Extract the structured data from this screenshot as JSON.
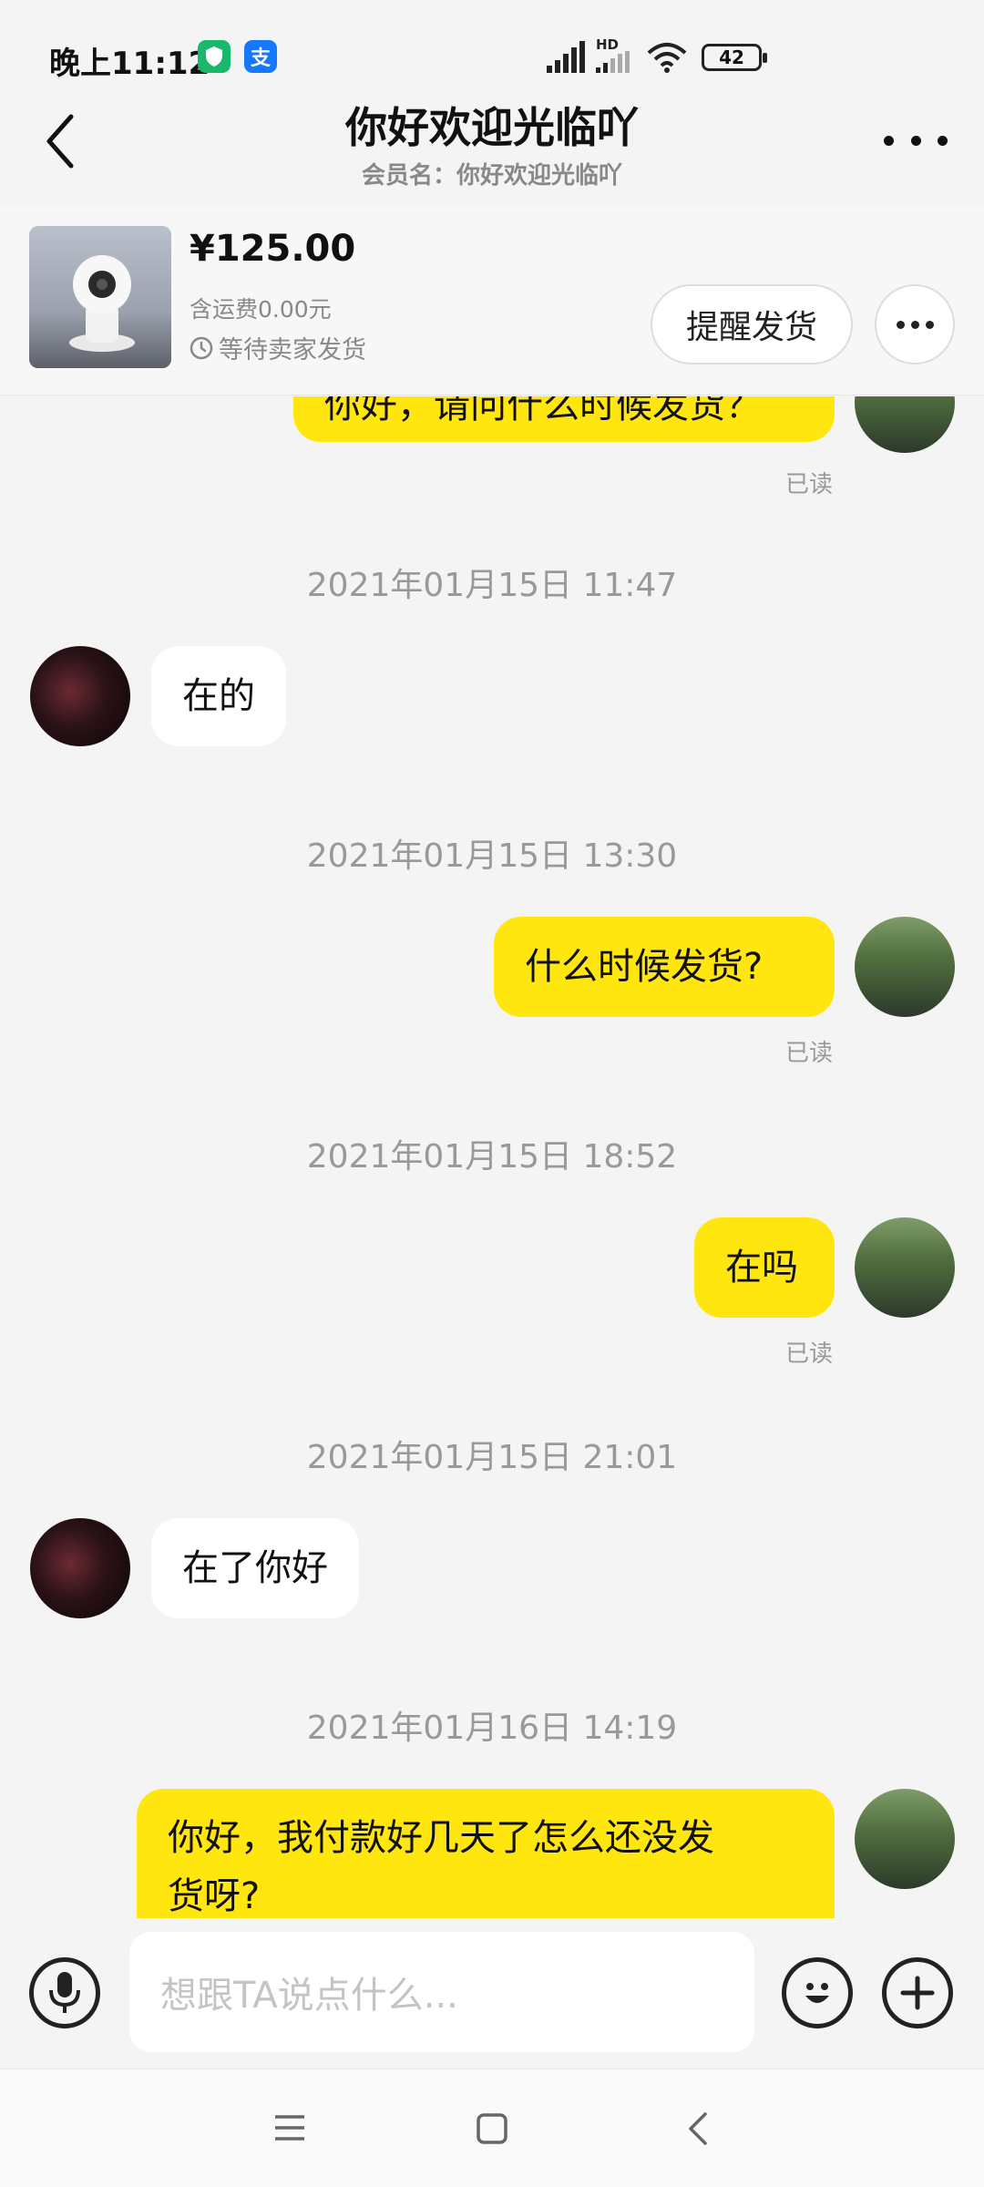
{
  "status_bar": {
    "time": "晚上11:12",
    "badge_shield_icon": "shield-icon",
    "badge_alipay_glyph": "支",
    "network_label": "HD",
    "battery": "42"
  },
  "header": {
    "title": "你好欢迎光临吖",
    "subtitle": "会员名：你好欢迎光临吖"
  },
  "product": {
    "price": "¥125.00",
    "shipping": "含运费0.00元",
    "status": "等待卖家发货",
    "remind_button": "提醒发货"
  },
  "messages": {
    "m0": "你好，请问什么时候发货？",
    "m0_read": "已读",
    "t1": "2021年01月15日 11:47",
    "m1": "在的",
    "t2": "2021年01月15日 13:30",
    "m2": "什么时候发货?",
    "m2_read": "已读",
    "t3": "2021年01月15日 18:52",
    "m3": "在吗",
    "m3_read": "已读",
    "t4": "2021年01月15日 21:01",
    "m4": "在了你好",
    "t5": "2021年01月16日 14:19",
    "m5_line1": "你好，我付款好几天了怎么还没发",
    "m5_line2": "货呀?"
  },
  "input": {
    "placeholder": "想跟TA说点什么..."
  },
  "colors": {
    "my_bubble": "#ffe60f",
    "their_bubble": "#ffffff",
    "background": "#f4f4f4"
  }
}
